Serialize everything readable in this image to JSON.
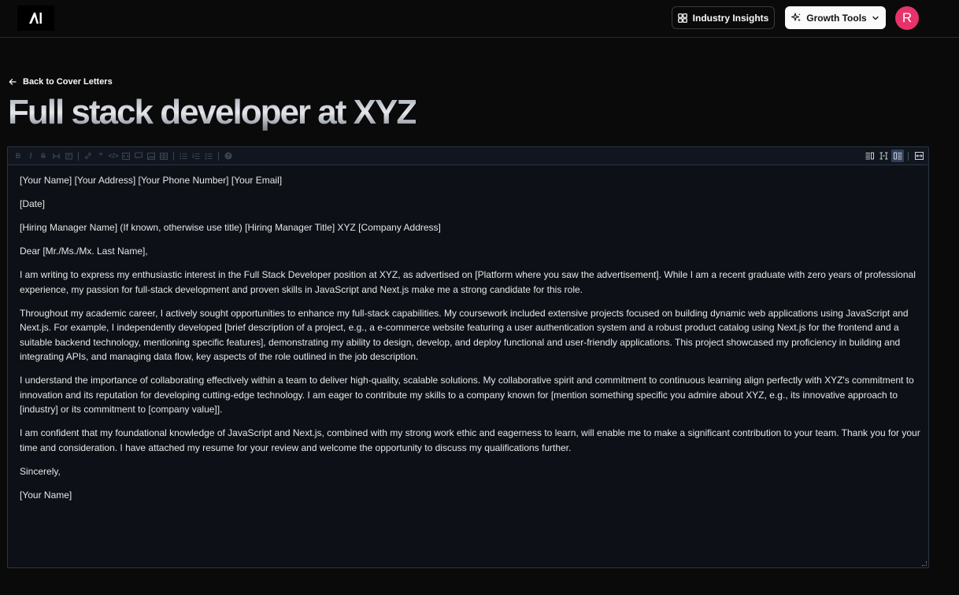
{
  "header": {
    "logo_text": "AI",
    "insights_label": "Industry Insights",
    "growth_label": "Growth Tools",
    "avatar_initial": "R"
  },
  "back_link": {
    "label": "Back to Cover Letters"
  },
  "page": {
    "title": "Full stack developer at XYZ"
  },
  "editor": {
    "toolbar_left_icons": [
      "bold-icon",
      "italic-icon",
      "strikethrough-icon",
      "heading-icon",
      "quote-icon",
      "link-icon",
      "code-icon",
      "code-block-icon",
      "comment-icon",
      "image-icon",
      "table-icon",
      "unordered-list-icon",
      "ordered-list-icon",
      "checklist-icon",
      "help-icon"
    ],
    "toolbar_right_icons": [
      "edit-mode-icon",
      "live-mode-icon",
      "preview-mode-icon",
      "fullscreen-icon"
    ],
    "paragraphs": [
      "[Your Name] [Your Address] [Your Phone Number] [Your Email]",
      "[Date]",
      "[Hiring Manager Name] (If known, otherwise use title) [Hiring Manager Title] XYZ [Company Address]",
      "Dear [Mr./Ms./Mx. Last Name],",
      "I am writing to express my enthusiastic interest in the Full Stack Developer position at XYZ, as advertised on [Platform where you saw the advertisement]. While I am a recent graduate with zero years of professional experience, my passion for full-stack development and proven skills in JavaScript and Next.js make me a strong candidate for this role.",
      "Throughout my academic career, I actively sought opportunities to enhance my full-stack capabilities. My coursework included extensive projects focused on building dynamic web applications using JavaScript and Next.js. For example, I independently developed [brief description of a project, e.g., a e-commerce website featuring a user authentication system and a robust product catalog using Next.js for the frontend and a suitable backend technology, mentioning specific features], demonstrating my ability to design, develop, and deploy functional and user-friendly applications. This project showcased my proficiency in building and integrating APIs, and managing data flow, key aspects of the role outlined in the job description.",
      "I understand the importance of collaborating effectively within a team to deliver high-quality, scalable solutions. My collaborative spirit and commitment to continuous learning align perfectly with XYZ's commitment to innovation and its reputation for developing cutting-edge technology. I am eager to contribute my skills to a company known for [mention something specific you admire about XYZ, e.g., its innovative approach to [industry] or its commitment to [company value]].",
      "I am confident that my foundational knowledge of JavaScript and Next.js, combined with my strong work ethic and eagerness to learn, will enable me to make a significant contribution to your team. Thank you for your time and consideration. I have attached my resume for your review and welcome the opportunity to discuss my qualifications further.",
      "Sincerely,",
      "[Your Name]"
    ]
  }
}
